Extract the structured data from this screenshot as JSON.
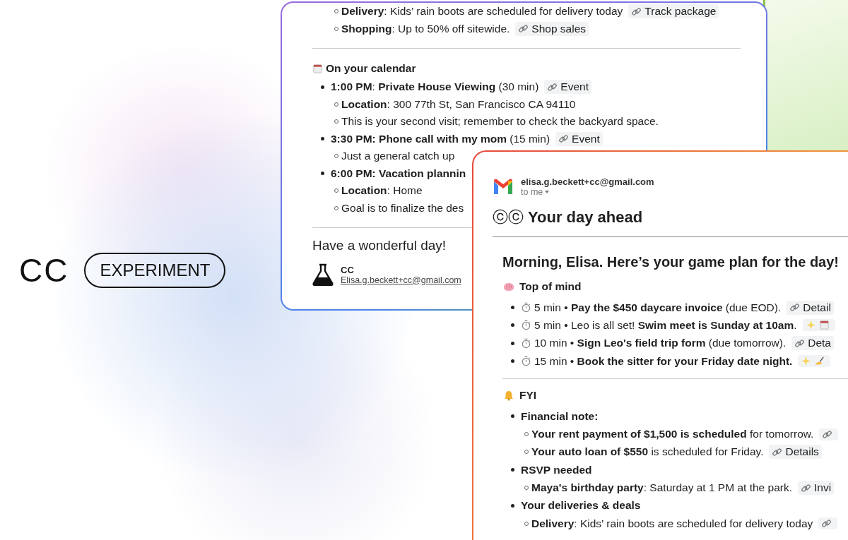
{
  "brand": {
    "logo": "CC",
    "badge": "EXPERIMENT"
  },
  "back_email": {
    "sections": [
      {
        "items": [
          {
            "children": [
              {
                "text": "**Delivery**: Kids’ rain boots are scheduled for delivery today",
                "chip": {
                  "kind": "link",
                  "label": "Track package"
                }
              },
              {
                "text": "**Shopping**: Up to 50% off sitewide.",
                "chip": {
                  "kind": "link",
                  "label": "Shop sales"
                }
              }
            ]
          }
        ]
      },
      {
        "kind": "schedule",
        "heading": "On your calendar",
        "items": [
          {
            "text": "**1:00 PM**: **Private House Viewing** (30 min)",
            "chip": {
              "kind": "link",
              "label": "Event"
            },
            "children": [
              {
                "text": "**Location**: 300 77th St, San Francisco CA 94110"
              },
              {
                "text": "This is your second visit; remember to check the backyard space."
              }
            ]
          },
          {
            "text": "**3:30 PM: Phone call with my mom** (15 min)",
            "chip": {
              "kind": "link",
              "label": "Event"
            },
            "children": [
              {
                "text": "Just a general catch up"
              }
            ]
          },
          {
            "text": "**6:00 PM: Vacation plannin**",
            "children": [
              {
                "text": "**Location**: Home"
              },
              {
                "text": "Goal is to finalize the des"
              }
            ]
          }
        ]
      }
    ],
    "closing": "Have a wonderful day!",
    "signature": {
      "name": "CC",
      "email": "Elisa.g.beckett+cc@gmail.com"
    }
  },
  "front_email": {
    "sender": "elisa.g.beckett+cc@gmail.com",
    "recipient": "to me",
    "subject_logo": "ⓒⓒ",
    "subject": "Your day ahead",
    "greeting": "Morning, Elisa. Here’s your game plan for the day!",
    "sections": [
      {
        "kind": "priorities",
        "heading": "Top of mind",
        "items": [
          {
            "kind": "timed",
            "text": "5 min • **Pay the $450 daycare invoice** (due EOD).",
            "chip": {
              "kind": "link",
              "label": "Detail"
            }
          },
          {
            "kind": "timed",
            "text": "5 min • Leo is all set! **Swim meet is Sunday at 10am**.",
            "chip": {
              "kind": "event_suggestion"
            }
          },
          {
            "kind": "timed",
            "text": "10 min • **Sign Leo's field trip form** (due tomorrow).",
            "chip": {
              "kind": "link",
              "label": "Deta"
            }
          },
          {
            "kind": "timed",
            "text": "15 min • **Book the sitter for your Friday date night.**",
            "chip": {
              "kind": "draft_suggestion"
            }
          }
        ]
      },
      {
        "kind": "notices",
        "heading": "FYI",
        "items": [
          {
            "text": "**Financial note:**",
            "children": [
              {
                "text": "**Your rent payment of $1,500 is scheduled** for tomorrow.",
                "chip": {
                  "kind": "link"
                }
              },
              {
                "text": "**Your auto loan of $550** is scheduled for Friday.",
                "chip": {
                  "kind": "link",
                  "label": "Details"
                }
              }
            ]
          },
          {
            "text": "**RSVP needed**",
            "children": [
              {
                "text": "**Maya's birthday party**: Saturday at 1 PM at the park.",
                "chip": {
                  "kind": "link",
                  "label": "Invi"
                }
              }
            ]
          },
          {
            "text": "**Your deliveries & deals**",
            "children": [
              {
                "text": "**Delivery**: Kids’ rain boots are scheduled for delivery today",
                "chip": {
                  "kind": "link"
                }
              }
            ]
          }
        ]
      }
    ]
  }
}
